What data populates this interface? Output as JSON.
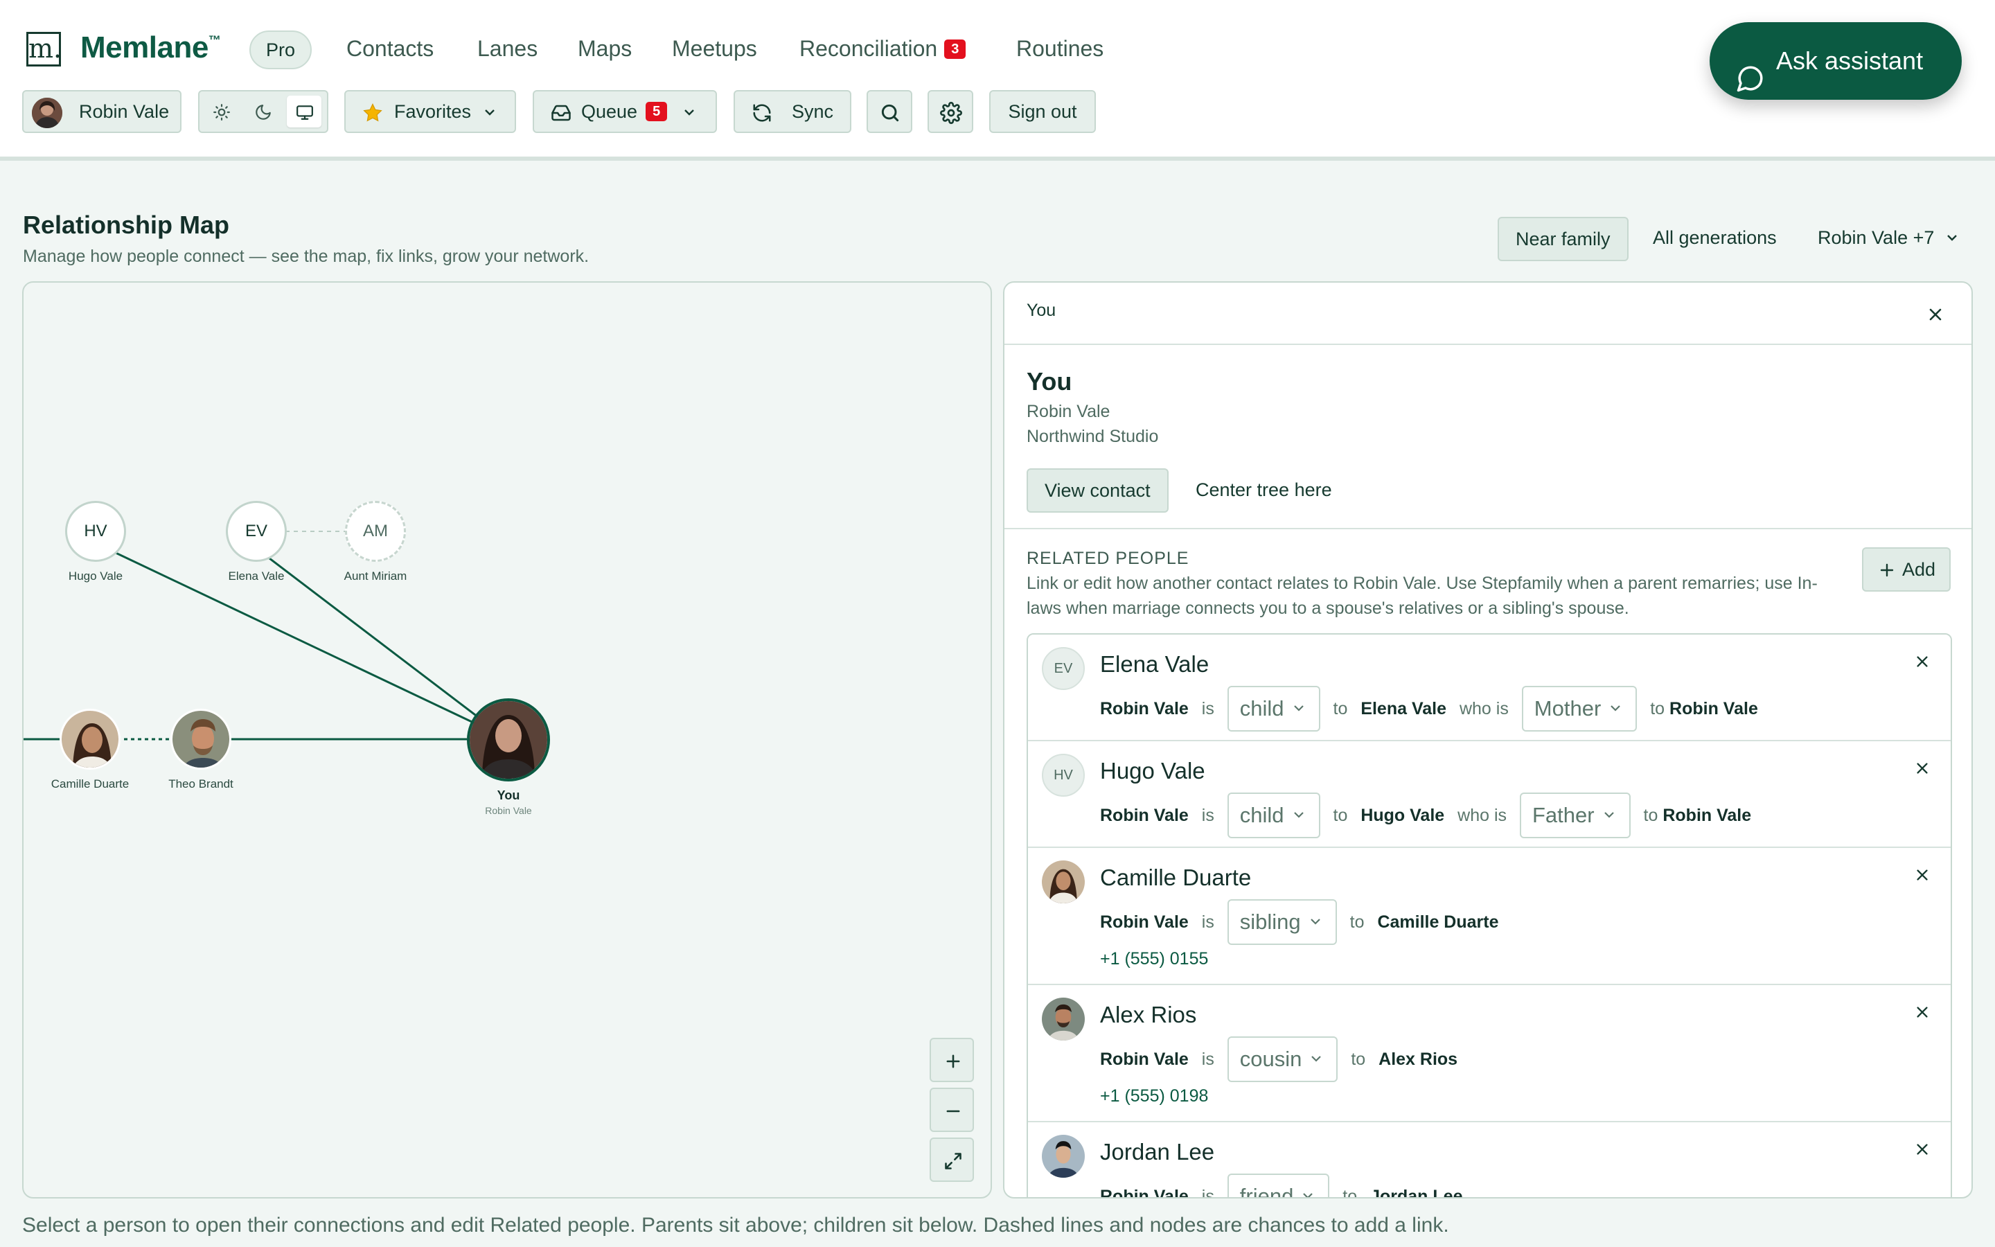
{
  "app": {
    "logo_mark": "m.",
    "name": "Memlane",
    "trademark": "™",
    "plan_badge": "Pro"
  },
  "nav": {
    "items": [
      {
        "label": "Contacts"
      },
      {
        "label": "Lanes"
      },
      {
        "label": "Maps"
      },
      {
        "label": "Meetups"
      },
      {
        "label": "Reconciliation",
        "badge": "3"
      },
      {
        "label": "Routines"
      }
    ]
  },
  "assistant": {
    "label": "Ask assistant"
  },
  "toolbar": {
    "user": "Robin Vale",
    "theme_modes": [
      "light",
      "dark",
      "system"
    ],
    "theme_active": "system",
    "favorites": "Favorites",
    "queue": "Queue",
    "queue_count": "5",
    "sync": "Sync",
    "sign_out": "Sign out"
  },
  "page": {
    "title": "Relationship Map",
    "subtitle": "Manage how people connect — see the map, fix links, grow your network.",
    "filters": [
      "Near family",
      "All generations",
      "Robin Vale +7"
    ],
    "filter_active": "Near family"
  },
  "map": {
    "nodes": [
      {
        "id": "hv",
        "initials": "HV",
        "label": "Hugo Vale"
      },
      {
        "id": "ev",
        "initials": "EV",
        "label": "Elena Vale"
      },
      {
        "id": "am",
        "initials": "AM",
        "label": "Aunt Miriam",
        "placeholder": true
      },
      {
        "id": "cd",
        "label": "Camille Duarte",
        "photo": true
      },
      {
        "id": "tb",
        "label": "Theo Brandt",
        "photo": true
      },
      {
        "id": "you",
        "label": "You",
        "sublabel": "Robin Vale",
        "photo": true
      }
    ],
    "zoom_controls": [
      "zoom-in",
      "zoom-out",
      "fit-to-screen"
    ]
  },
  "detail": {
    "header": "You",
    "name": "You",
    "full_name": "Robin Vale",
    "company": "Northwind Studio",
    "view_contact": "View contact",
    "center_tree": "Center tree here",
    "related_title": "RELATED PEOPLE",
    "related_desc": "Link or edit how another contact relates to Robin Vale. Use Stepfamily when a parent remarries; use In-laws when marriage connects you to a spouse's relatives or a sibling's spouse.",
    "add_label": "Add",
    "related": [
      {
        "name": "Elena Vale",
        "initials": "EV",
        "subject": "Robin Vale",
        "is": "is",
        "relation": "child",
        "to": "to",
        "target": "Elena Vale",
        "who_is": "who is",
        "reverse": "Mother",
        "to2": "to",
        "target2": "Robin Vale"
      },
      {
        "name": "Hugo Vale",
        "initials": "HV",
        "subject": "Robin Vale",
        "is": "is",
        "relation": "child",
        "to": "to",
        "target": "Hugo Vale",
        "who_is": "who is",
        "reverse": "Father",
        "to2": "to",
        "target2": "Robin Vale"
      },
      {
        "name": "Camille Duarte",
        "subject": "Robin Vale",
        "is": "is",
        "relation": "sibling",
        "to": "to",
        "target": "Camille Duarte",
        "phone": "+1 (555) 0155"
      },
      {
        "name": "Alex Rios",
        "subject": "Robin Vale",
        "is": "is",
        "relation": "cousin",
        "to": "to",
        "target": "Alex Rios",
        "phone": "+1 (555) 0198"
      },
      {
        "name": "Jordan Lee",
        "subject": "Robin Vale",
        "is": "is",
        "relation": "friend",
        "to": "to",
        "target": "Jordan Lee"
      }
    ]
  },
  "footer": {
    "hint": "Select a person to open their connections and edit Related people. Parents sit above; children sit below. Dashed lines and nodes are chances to add a link."
  },
  "colors": {
    "brand": "#0b5a42",
    "badge": "#e3101e",
    "background": "#f1f6f4"
  }
}
